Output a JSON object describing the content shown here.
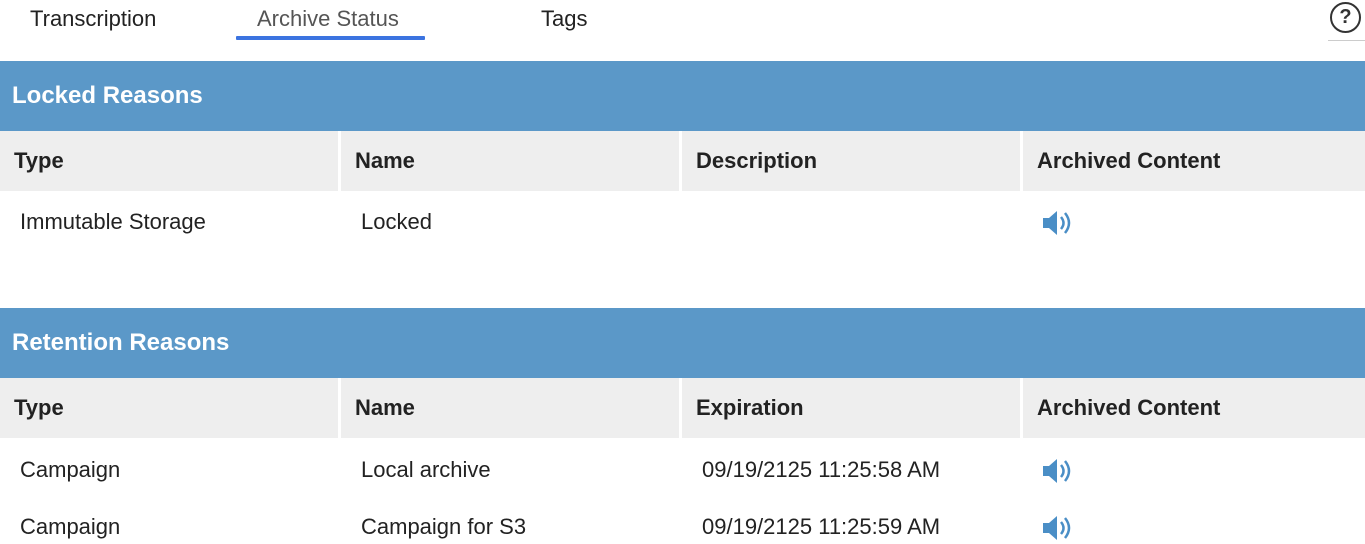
{
  "tabs": [
    {
      "label": "Transcription",
      "active": false
    },
    {
      "label": "Archive Status",
      "active": true
    },
    {
      "label": "Tags",
      "active": false
    }
  ],
  "help": {
    "label": "?",
    "icon": "help-circle-icon"
  },
  "colors": {
    "accent": "#3b73e0",
    "section_header": "#5b98c8",
    "table_header": "#eeeeee",
    "icon": "#4a8ec6"
  },
  "locked": {
    "title": "Locked Reasons",
    "columns": [
      "Type",
      "Name",
      "Description",
      "Archived Content"
    ],
    "rows": [
      {
        "type": "Immutable Storage",
        "name": "Locked",
        "description": "",
        "archived_icon": "speaker-icon"
      }
    ]
  },
  "retention": {
    "title": "Retention Reasons",
    "columns": [
      "Type",
      "Name",
      "Expiration",
      "Archived Content"
    ],
    "rows": [
      {
        "type": "Campaign",
        "name": "Local archive",
        "expiration": "09/19/2125 11:25:58 AM",
        "archived_icon": "speaker-icon"
      },
      {
        "type": "Campaign",
        "name": "Campaign for S3",
        "expiration": "09/19/2125 11:25:59 AM",
        "archived_icon": "speaker-icon"
      }
    ]
  }
}
